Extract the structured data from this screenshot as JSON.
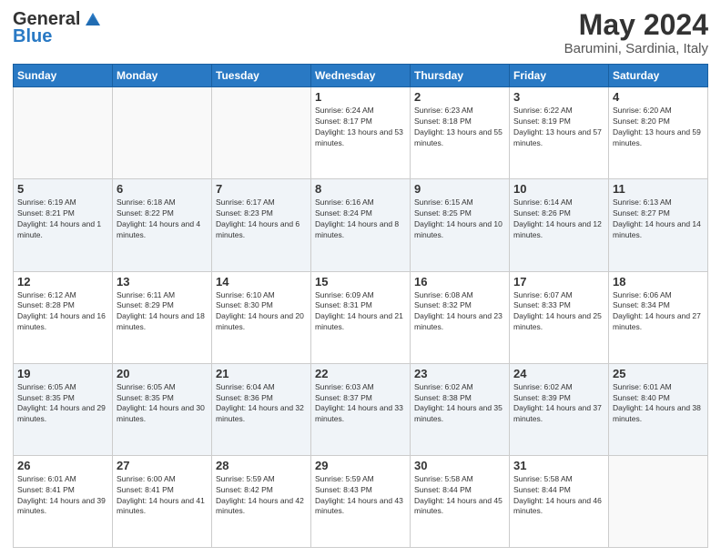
{
  "header": {
    "logo_general": "General",
    "logo_blue": "Blue",
    "month_year": "May 2024",
    "location": "Barumini, Sardinia, Italy"
  },
  "weekdays": [
    "Sunday",
    "Monday",
    "Tuesday",
    "Wednesday",
    "Thursday",
    "Friday",
    "Saturday"
  ],
  "weeks": [
    [
      {
        "date": "",
        "sunrise": "",
        "sunset": "",
        "daylight": ""
      },
      {
        "date": "",
        "sunrise": "",
        "sunset": "",
        "daylight": ""
      },
      {
        "date": "",
        "sunrise": "",
        "sunset": "",
        "daylight": ""
      },
      {
        "date": "1",
        "sunrise": "Sunrise: 6:24 AM",
        "sunset": "Sunset: 8:17 PM",
        "daylight": "Daylight: 13 hours and 53 minutes."
      },
      {
        "date": "2",
        "sunrise": "Sunrise: 6:23 AM",
        "sunset": "Sunset: 8:18 PM",
        "daylight": "Daylight: 13 hours and 55 minutes."
      },
      {
        "date": "3",
        "sunrise": "Sunrise: 6:22 AM",
        "sunset": "Sunset: 8:19 PM",
        "daylight": "Daylight: 13 hours and 57 minutes."
      },
      {
        "date": "4",
        "sunrise": "Sunrise: 6:20 AM",
        "sunset": "Sunset: 8:20 PM",
        "daylight": "Daylight: 13 hours and 59 minutes."
      }
    ],
    [
      {
        "date": "5",
        "sunrise": "Sunrise: 6:19 AM",
        "sunset": "Sunset: 8:21 PM",
        "daylight": "Daylight: 14 hours and 1 minute."
      },
      {
        "date": "6",
        "sunrise": "Sunrise: 6:18 AM",
        "sunset": "Sunset: 8:22 PM",
        "daylight": "Daylight: 14 hours and 4 minutes."
      },
      {
        "date": "7",
        "sunrise": "Sunrise: 6:17 AM",
        "sunset": "Sunset: 8:23 PM",
        "daylight": "Daylight: 14 hours and 6 minutes."
      },
      {
        "date": "8",
        "sunrise": "Sunrise: 6:16 AM",
        "sunset": "Sunset: 8:24 PM",
        "daylight": "Daylight: 14 hours and 8 minutes."
      },
      {
        "date": "9",
        "sunrise": "Sunrise: 6:15 AM",
        "sunset": "Sunset: 8:25 PM",
        "daylight": "Daylight: 14 hours and 10 minutes."
      },
      {
        "date": "10",
        "sunrise": "Sunrise: 6:14 AM",
        "sunset": "Sunset: 8:26 PM",
        "daylight": "Daylight: 14 hours and 12 minutes."
      },
      {
        "date": "11",
        "sunrise": "Sunrise: 6:13 AM",
        "sunset": "Sunset: 8:27 PM",
        "daylight": "Daylight: 14 hours and 14 minutes."
      }
    ],
    [
      {
        "date": "12",
        "sunrise": "Sunrise: 6:12 AM",
        "sunset": "Sunset: 8:28 PM",
        "daylight": "Daylight: 14 hours and 16 minutes."
      },
      {
        "date": "13",
        "sunrise": "Sunrise: 6:11 AM",
        "sunset": "Sunset: 8:29 PM",
        "daylight": "Daylight: 14 hours and 18 minutes."
      },
      {
        "date": "14",
        "sunrise": "Sunrise: 6:10 AM",
        "sunset": "Sunset: 8:30 PM",
        "daylight": "Daylight: 14 hours and 20 minutes."
      },
      {
        "date": "15",
        "sunrise": "Sunrise: 6:09 AM",
        "sunset": "Sunset: 8:31 PM",
        "daylight": "Daylight: 14 hours and 21 minutes."
      },
      {
        "date": "16",
        "sunrise": "Sunrise: 6:08 AM",
        "sunset": "Sunset: 8:32 PM",
        "daylight": "Daylight: 14 hours and 23 minutes."
      },
      {
        "date": "17",
        "sunrise": "Sunrise: 6:07 AM",
        "sunset": "Sunset: 8:33 PM",
        "daylight": "Daylight: 14 hours and 25 minutes."
      },
      {
        "date": "18",
        "sunrise": "Sunrise: 6:06 AM",
        "sunset": "Sunset: 8:34 PM",
        "daylight": "Daylight: 14 hours and 27 minutes."
      }
    ],
    [
      {
        "date": "19",
        "sunrise": "Sunrise: 6:05 AM",
        "sunset": "Sunset: 8:35 PM",
        "daylight": "Daylight: 14 hours and 29 minutes."
      },
      {
        "date": "20",
        "sunrise": "Sunrise: 6:05 AM",
        "sunset": "Sunset: 8:35 PM",
        "daylight": "Daylight: 14 hours and 30 minutes."
      },
      {
        "date": "21",
        "sunrise": "Sunrise: 6:04 AM",
        "sunset": "Sunset: 8:36 PM",
        "daylight": "Daylight: 14 hours and 32 minutes."
      },
      {
        "date": "22",
        "sunrise": "Sunrise: 6:03 AM",
        "sunset": "Sunset: 8:37 PM",
        "daylight": "Daylight: 14 hours and 33 minutes."
      },
      {
        "date": "23",
        "sunrise": "Sunrise: 6:02 AM",
        "sunset": "Sunset: 8:38 PM",
        "daylight": "Daylight: 14 hours and 35 minutes."
      },
      {
        "date": "24",
        "sunrise": "Sunrise: 6:02 AM",
        "sunset": "Sunset: 8:39 PM",
        "daylight": "Daylight: 14 hours and 37 minutes."
      },
      {
        "date": "25",
        "sunrise": "Sunrise: 6:01 AM",
        "sunset": "Sunset: 8:40 PM",
        "daylight": "Daylight: 14 hours and 38 minutes."
      }
    ],
    [
      {
        "date": "26",
        "sunrise": "Sunrise: 6:01 AM",
        "sunset": "Sunset: 8:41 PM",
        "daylight": "Daylight: 14 hours and 39 minutes."
      },
      {
        "date": "27",
        "sunrise": "Sunrise: 6:00 AM",
        "sunset": "Sunset: 8:41 PM",
        "daylight": "Daylight: 14 hours and 41 minutes."
      },
      {
        "date": "28",
        "sunrise": "Sunrise: 5:59 AM",
        "sunset": "Sunset: 8:42 PM",
        "daylight": "Daylight: 14 hours and 42 minutes."
      },
      {
        "date": "29",
        "sunrise": "Sunrise: 5:59 AM",
        "sunset": "Sunset: 8:43 PM",
        "daylight": "Daylight: 14 hours and 43 minutes."
      },
      {
        "date": "30",
        "sunrise": "Sunrise: 5:58 AM",
        "sunset": "Sunset: 8:44 PM",
        "daylight": "Daylight: 14 hours and 45 minutes."
      },
      {
        "date": "31",
        "sunrise": "Sunrise: 5:58 AM",
        "sunset": "Sunset: 8:44 PM",
        "daylight": "Daylight: 14 hours and 46 minutes."
      },
      {
        "date": "",
        "sunrise": "",
        "sunset": "",
        "daylight": ""
      }
    ]
  ]
}
